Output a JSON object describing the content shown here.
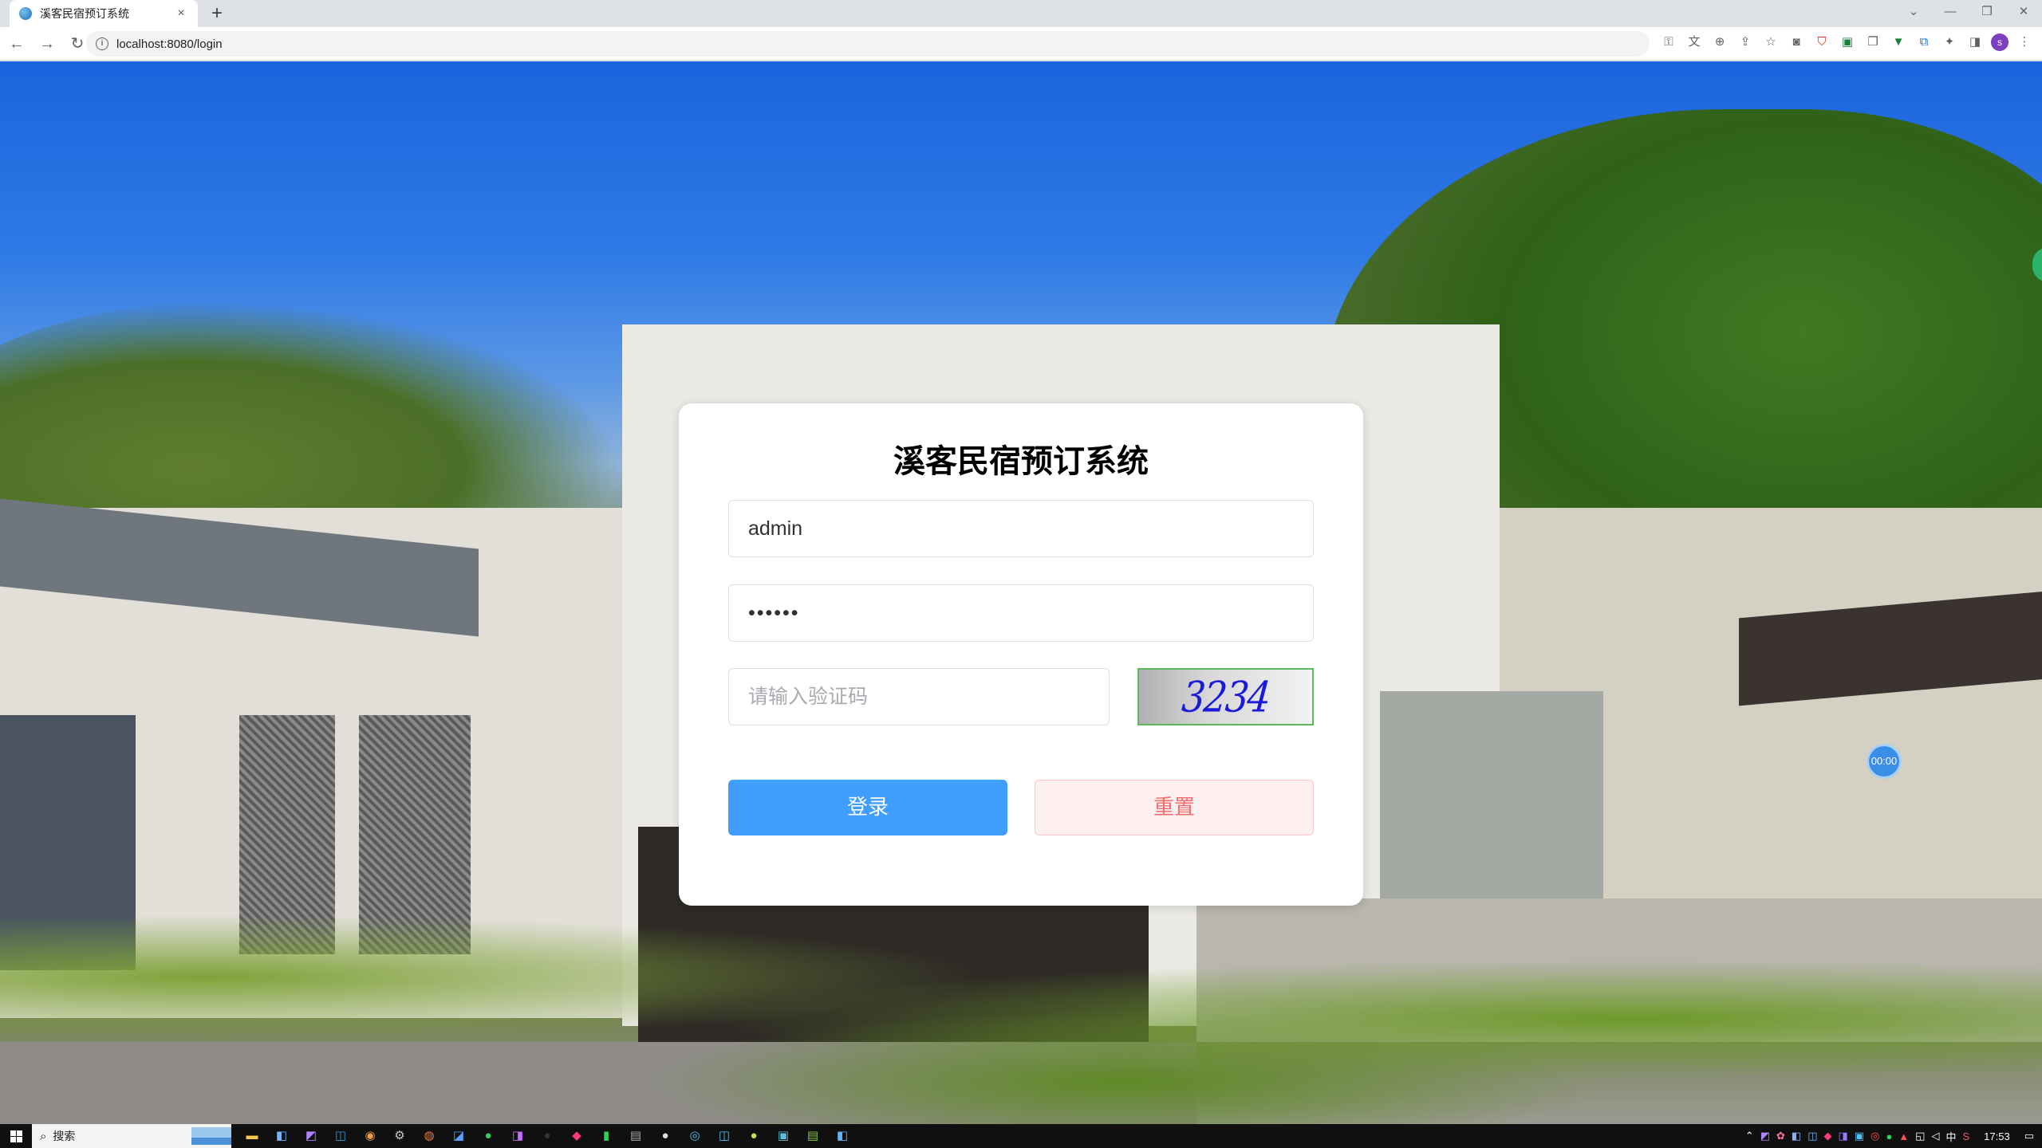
{
  "browser": {
    "tab_title": "溪客民宿预订系统",
    "tab_close": "×",
    "new_tab": "+",
    "url": "localhost:8080/login",
    "window_controls": [
      "⌄",
      "—",
      "❐",
      "✕"
    ]
  },
  "nav": {
    "back": "←",
    "forward": "→",
    "reload": "↻"
  },
  "toolbar_icons": [
    "key-icon",
    "translate-icon",
    "zoom-icon",
    "share-icon",
    "bookmark-star-icon",
    "camera-icon",
    "shield-extension-icon",
    "extension-green-icon",
    "copy-extension-icon",
    "vue-devtools-icon",
    "translate-extension-icon",
    "puzzle-extensions-icon",
    "side-panel-icon",
    "profile-avatar",
    "menu-kebab-icon"
  ],
  "profile_initial": "s",
  "login": {
    "title": "溪客民宿预订系统",
    "username_value": "admin",
    "password_value": "••••••",
    "captcha_placeholder": "请输入验证码",
    "captcha_code": "3234",
    "login_button": "登录",
    "reset_button": "重置"
  },
  "overlay": {
    "timer": "00:00"
  },
  "taskbar": {
    "search_label": "搜索",
    "clock": "17:53",
    "ime": "中"
  }
}
